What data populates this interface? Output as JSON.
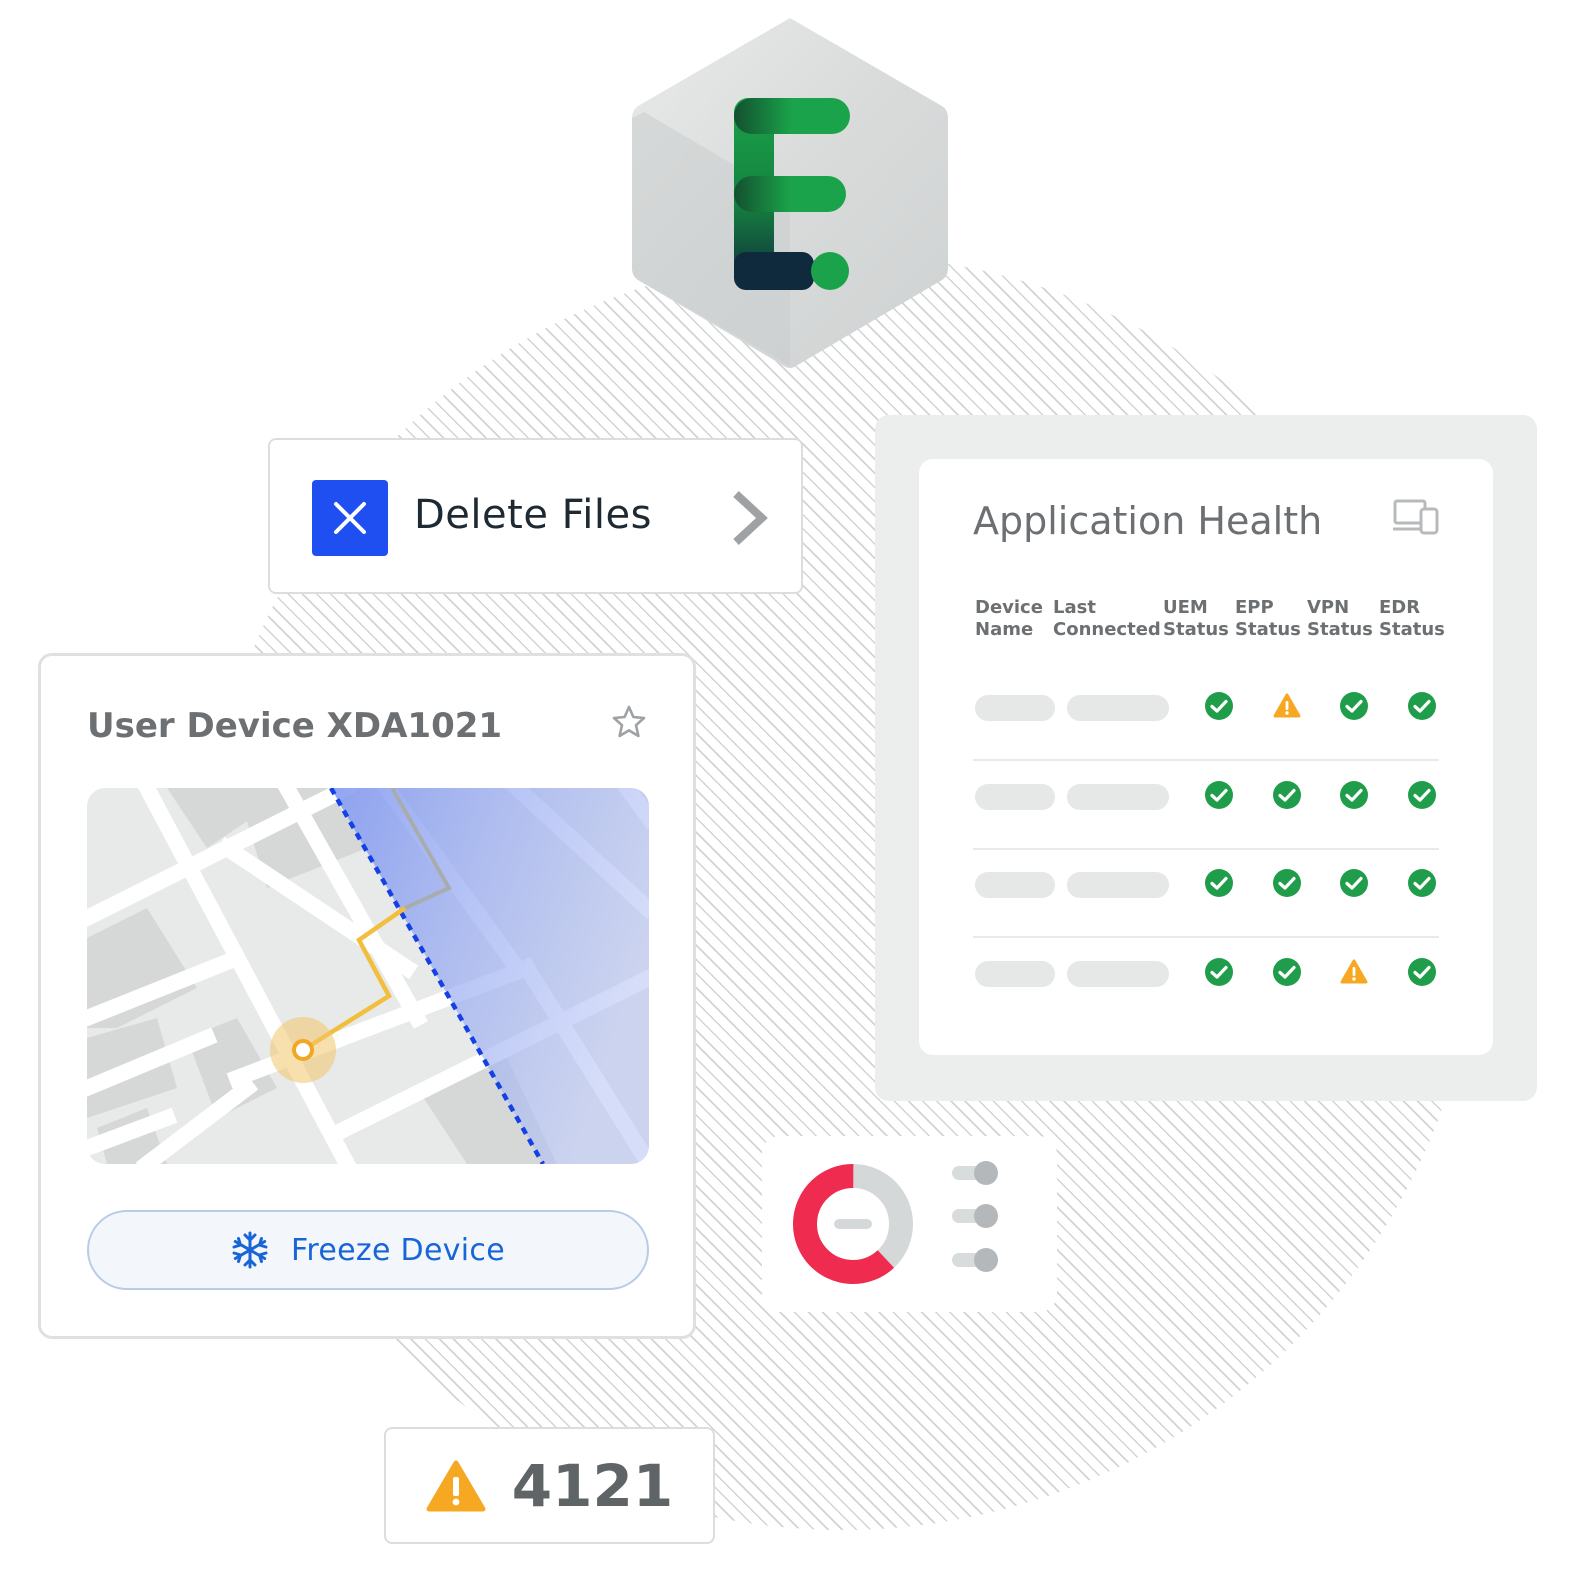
{
  "logo": {
    "letter_icon": "e-logo-icon",
    "color_top": "#1aa34a",
    "color_bottom": "#0f2a3d"
  },
  "delete_files": {
    "label": "Delete Files",
    "icon": "close-icon",
    "accent": "#1f4ff0"
  },
  "health": {
    "title": "Application Health",
    "columns": [
      "Device\nName",
      "Last\nConnected",
      "UEM\nStatus",
      "EPP\nStatus",
      "VPN\nStatus",
      "EDR\nStatus"
    ],
    "rows": [
      [
        "ok",
        "warn",
        "ok",
        "ok"
      ],
      [
        "ok",
        "ok",
        "ok",
        "ok"
      ],
      [
        "ok",
        "ok",
        "ok",
        "ok"
      ],
      [
        "ok",
        "ok",
        "warn",
        "ok"
      ]
    ],
    "ok_color": "#1f9d4a",
    "warn_color": "#f7a823"
  },
  "device": {
    "title": "User Device XDA1021",
    "freeze_label": "Freeze Device",
    "freeze_color": "#1765d6"
  },
  "donut": {
    "primary_fraction": 0.62,
    "primary_color": "#ef2b50",
    "secondary_color": "#d5d8d9"
  },
  "alert": {
    "count": "4121",
    "icon": "warning-icon"
  }
}
